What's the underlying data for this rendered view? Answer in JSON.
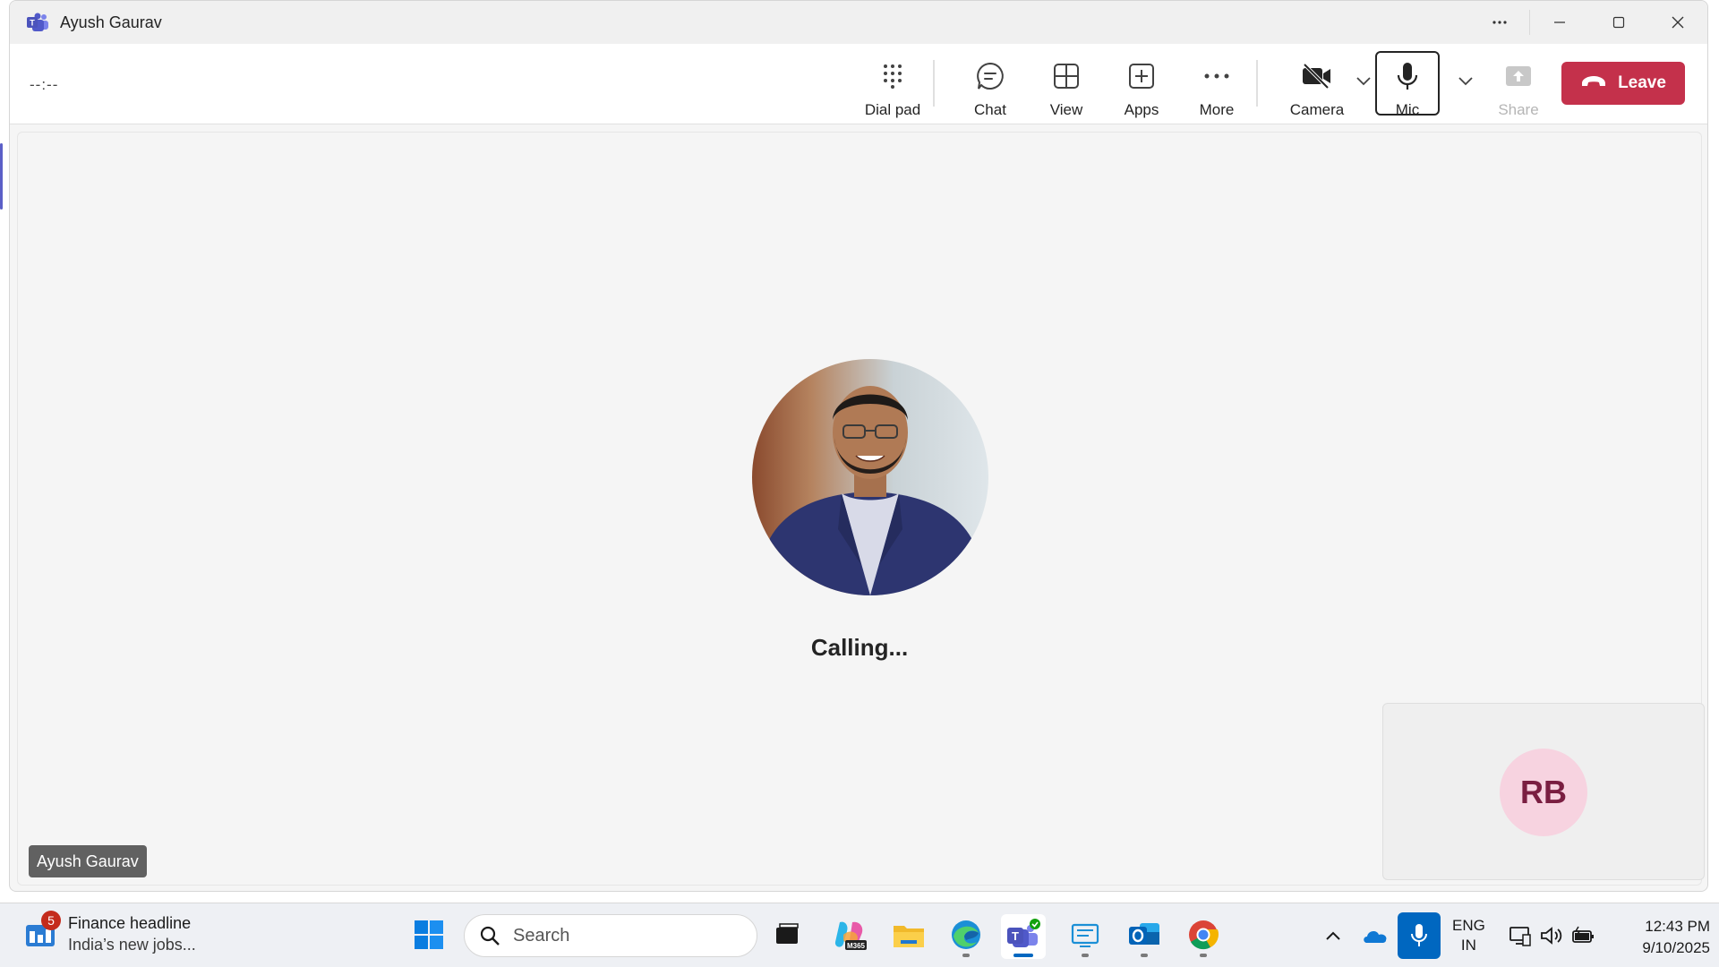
{
  "window": {
    "title": "Ayush Gaurav",
    "controls": {
      "more": "more-options",
      "minimize": "minimize",
      "maximize": "maximize",
      "close": "close"
    }
  },
  "toolbar": {
    "timer": "--:--",
    "dialpad": "Dial pad",
    "chat": "Chat",
    "view": "View",
    "apps": "Apps",
    "more": "More",
    "camera": "Camera",
    "mic": "Mic",
    "share": "Share",
    "leave": "Leave"
  },
  "stage": {
    "status": "Calling...",
    "participant_name": "Ayush Gaurav",
    "self_initials": "RB"
  },
  "colors": {
    "leave": "#c4314b",
    "teams_accent": "#5b5fc7",
    "self_avatar_bg": "#f7d3e0",
    "self_avatar_text": "#7a1e41"
  },
  "taskbar": {
    "widget": {
      "badge": "5",
      "headline": "Finance headline",
      "subtext": "India’s new jobs..."
    },
    "search_placeholder": "Search",
    "apps": [
      "start",
      "task-view",
      "m365-copilot",
      "file-explorer",
      "edge",
      "teams",
      "remote-desktop",
      "outlook",
      "chrome"
    ],
    "lang_line1": "ENG",
    "lang_line2": "IN",
    "time": "12:43 PM",
    "date": "9/10/2025"
  }
}
